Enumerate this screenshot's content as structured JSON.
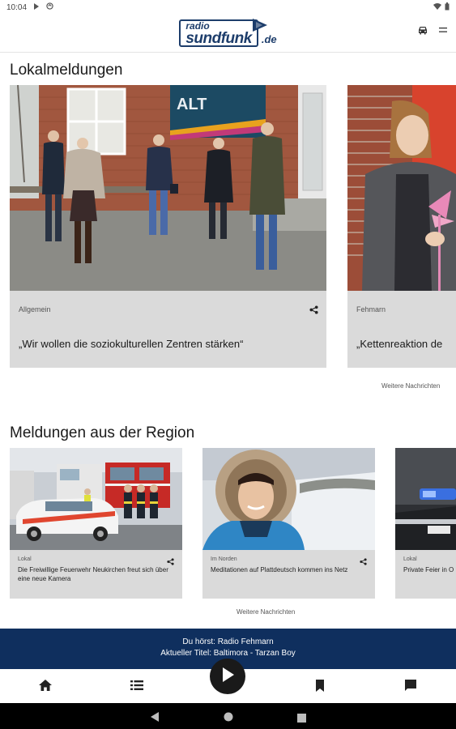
{
  "statusbar": {
    "time": "10:04"
  },
  "logo": {
    "radio": "radio",
    "sundfunk": "sundfunk",
    "tld": ".de"
  },
  "local": {
    "title": "Lokalmeldungen",
    "cards": [
      {
        "category": "Allgemein",
        "headline": "„Wir wollen die soziokulturellen Zentren stärken“",
        "banner": "ALT"
      },
      {
        "category": "Fehmarn",
        "headline": "„Kettenreaktion de"
      }
    ],
    "more": "Weitere Nachrichten"
  },
  "region": {
    "title": "Meldungen aus der Region",
    "cards": [
      {
        "category": "Lokal",
        "headline": "Die Freiwillige Feuerwehr Neukirchen freut sich über eine neue Kamera"
      },
      {
        "category": "Im Norden",
        "headline": "Meditationen auf Plattdeutsch kommen ins Netz"
      },
      {
        "category": "Lokal",
        "headline": "Private Feier in O"
      }
    ],
    "more": "Weitere Nachrichten"
  },
  "player": {
    "station_line": "Du hörst: Radio Fehmarn",
    "track_line": "Aktueller Titel: Baltimora - Tarzan Boy"
  },
  "colors": {
    "brand": "#0f2f5e",
    "card_bg": "#dadada",
    "logo": "#1d3d6b"
  },
  "icons": {
    "nav": [
      "home-icon",
      "list-icon",
      "play-icon",
      "bookmark-icon",
      "chat-icon"
    ],
    "appbar": [
      "car-icon",
      "menu-icon"
    ],
    "card": "share-icon"
  }
}
